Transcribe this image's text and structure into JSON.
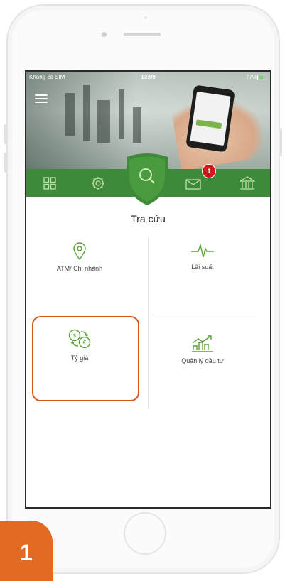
{
  "status_bar": {
    "carrier": "Không có SIM",
    "time": "13:09",
    "battery": "77%"
  },
  "nav": {
    "items": [
      {
        "icon": "grid-icon"
      },
      {
        "icon": "settings-icon"
      },
      {
        "icon": "search-icon",
        "active": true
      },
      {
        "icon": "mail-icon",
        "badge": "1"
      },
      {
        "icon": "bank-icon"
      }
    ]
  },
  "page": {
    "title": "Tra cứu"
  },
  "tiles": [
    {
      "label": "ATM/ Chi nhánh",
      "icon": "location-pin-icon"
    },
    {
      "label": "Lãi suất",
      "icon": "pulse-icon"
    },
    {
      "label": "Tỷ giá",
      "icon": "currency-exchange-icon",
      "highlighted": true
    },
    {
      "label": "Quản lý đầu tư",
      "icon": "investment-chart-icon"
    }
  ],
  "step_badge": "1",
  "colors": {
    "brand_green": "#3f8a3a",
    "icon_green": "#5aa13a",
    "highlight_orange": "#d4551d",
    "step_orange": "#e26a22",
    "badge_red": "#d3151d"
  }
}
